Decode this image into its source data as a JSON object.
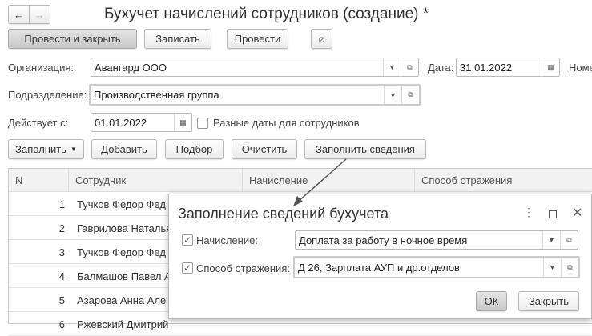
{
  "header": {
    "title": "Бухучет начислений сотрудников (создание) *",
    "back": "←",
    "forward": "→"
  },
  "toolbar": {
    "post_close": "Провести и закрыть",
    "save": "Записать",
    "post": "Провести"
  },
  "form": {
    "org_label": "Организация:",
    "org_value": "Авангард ООО",
    "date_label": "Дата:",
    "date_value": "31.01.2022",
    "number_label": "Номе",
    "dept_label": "Подразделение:",
    "dept_value": "Производственная группа",
    "from_label": "Действует с:",
    "from_value": "01.01.2022",
    "diff_dates_label": "Разные даты для сотрудников"
  },
  "table_toolbar": {
    "fill": "Заполнить",
    "add": "Добавить",
    "select": "Подбор",
    "clear": "Очистить",
    "fill_info": "Заполнить сведения"
  },
  "table": {
    "columns": [
      "N",
      "Сотрудник",
      "Начисление",
      "Способ отражения"
    ],
    "rows": [
      {
        "n": "1",
        "name": "Тучков Федор Фед"
      },
      {
        "n": "2",
        "name": "Гаврилова Наталья"
      },
      {
        "n": "3",
        "name": "Тучков Федор Фед"
      },
      {
        "n": "4",
        "name": "Балмашов Павел А"
      },
      {
        "n": "5",
        "name": "Азарова Анна Але"
      },
      {
        "n": "6",
        "name": "Ржевский Дмитрий"
      }
    ]
  },
  "dialog": {
    "title": "Заполнение сведений бухучета",
    "accrual_label": "Начисление:",
    "accrual_value": "Доплата за работу в ночное время",
    "method_label": "Способ отражения:",
    "method_value": "Д 26, Зарплата АУП и др.отделов",
    "ok": "ОК",
    "close": "Закрыть"
  }
}
